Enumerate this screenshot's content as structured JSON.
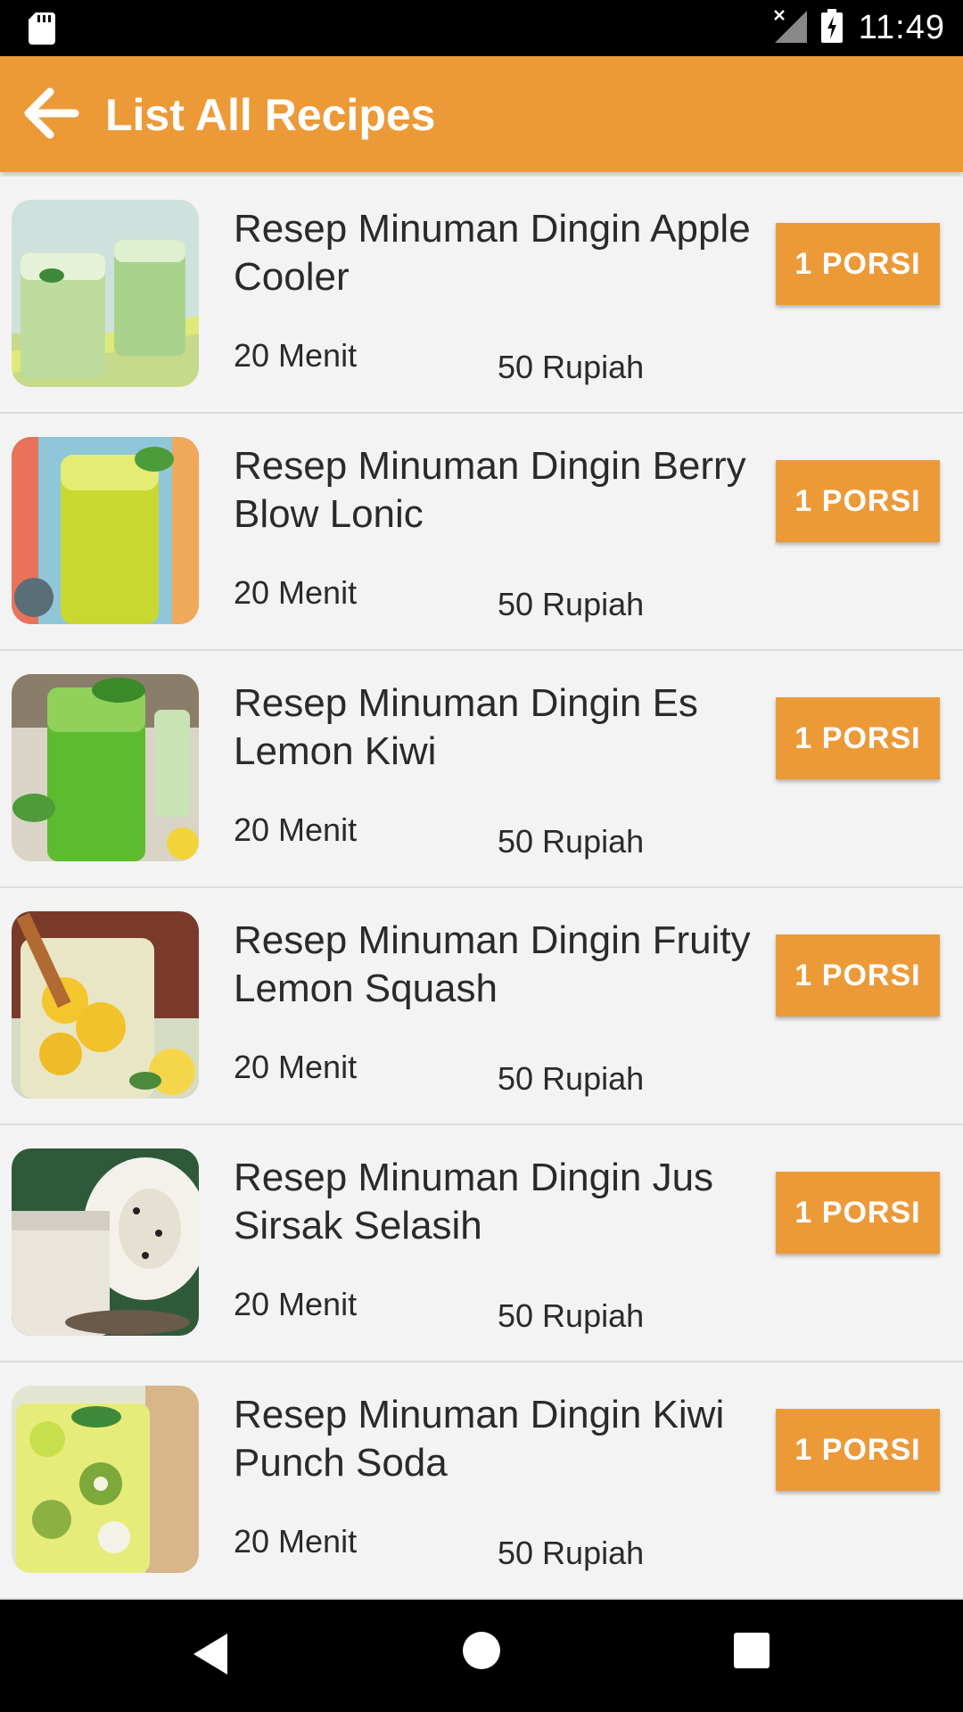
{
  "status_bar": {
    "time": "11:49"
  },
  "app_bar": {
    "title": "List All Recipes"
  },
  "recipes": [
    {
      "title": "Resep Minuman Dingin Apple Cooler",
      "time": "20 Menit",
      "price": "50 Rupiah",
      "button": "1 PORSI"
    },
    {
      "title": "Resep Minuman Dingin Berry Blow Lonic",
      "time": "20 Menit",
      "price": "50 Rupiah",
      "button": "1 PORSI"
    },
    {
      "title": "Resep Minuman Dingin Es Lemon Kiwi",
      "time": "20 Menit",
      "price": "50 Rupiah",
      "button": "1 PORSI"
    },
    {
      "title": "Resep Minuman Dingin Fruity Lemon Squash",
      "time": "20 Menit",
      "price": "50 Rupiah",
      "button": "1 PORSI"
    },
    {
      "title": "Resep Minuman Dingin Jus Sirsak Selasih",
      "time": "20 Menit",
      "price": "50 Rupiah",
      "button": "1 PORSI"
    },
    {
      "title": "Resep Minuman Dingin Kiwi Punch Soda",
      "time": "20 Menit",
      "price": "50 Rupiah",
      "button": "1 PORSI"
    }
  ],
  "colors": {
    "accent": "#ec9a38",
    "background": "#f3f3f3",
    "text": "#2a2a2a"
  },
  "icons": {
    "status_left": "sd-card-icon",
    "status_signal": "signal-icon",
    "status_battery": "battery-charging-icon",
    "app_bar_back": "arrow-back-icon",
    "nav": [
      "nav-back-icon",
      "nav-home-icon",
      "nav-recents-icon"
    ]
  }
}
